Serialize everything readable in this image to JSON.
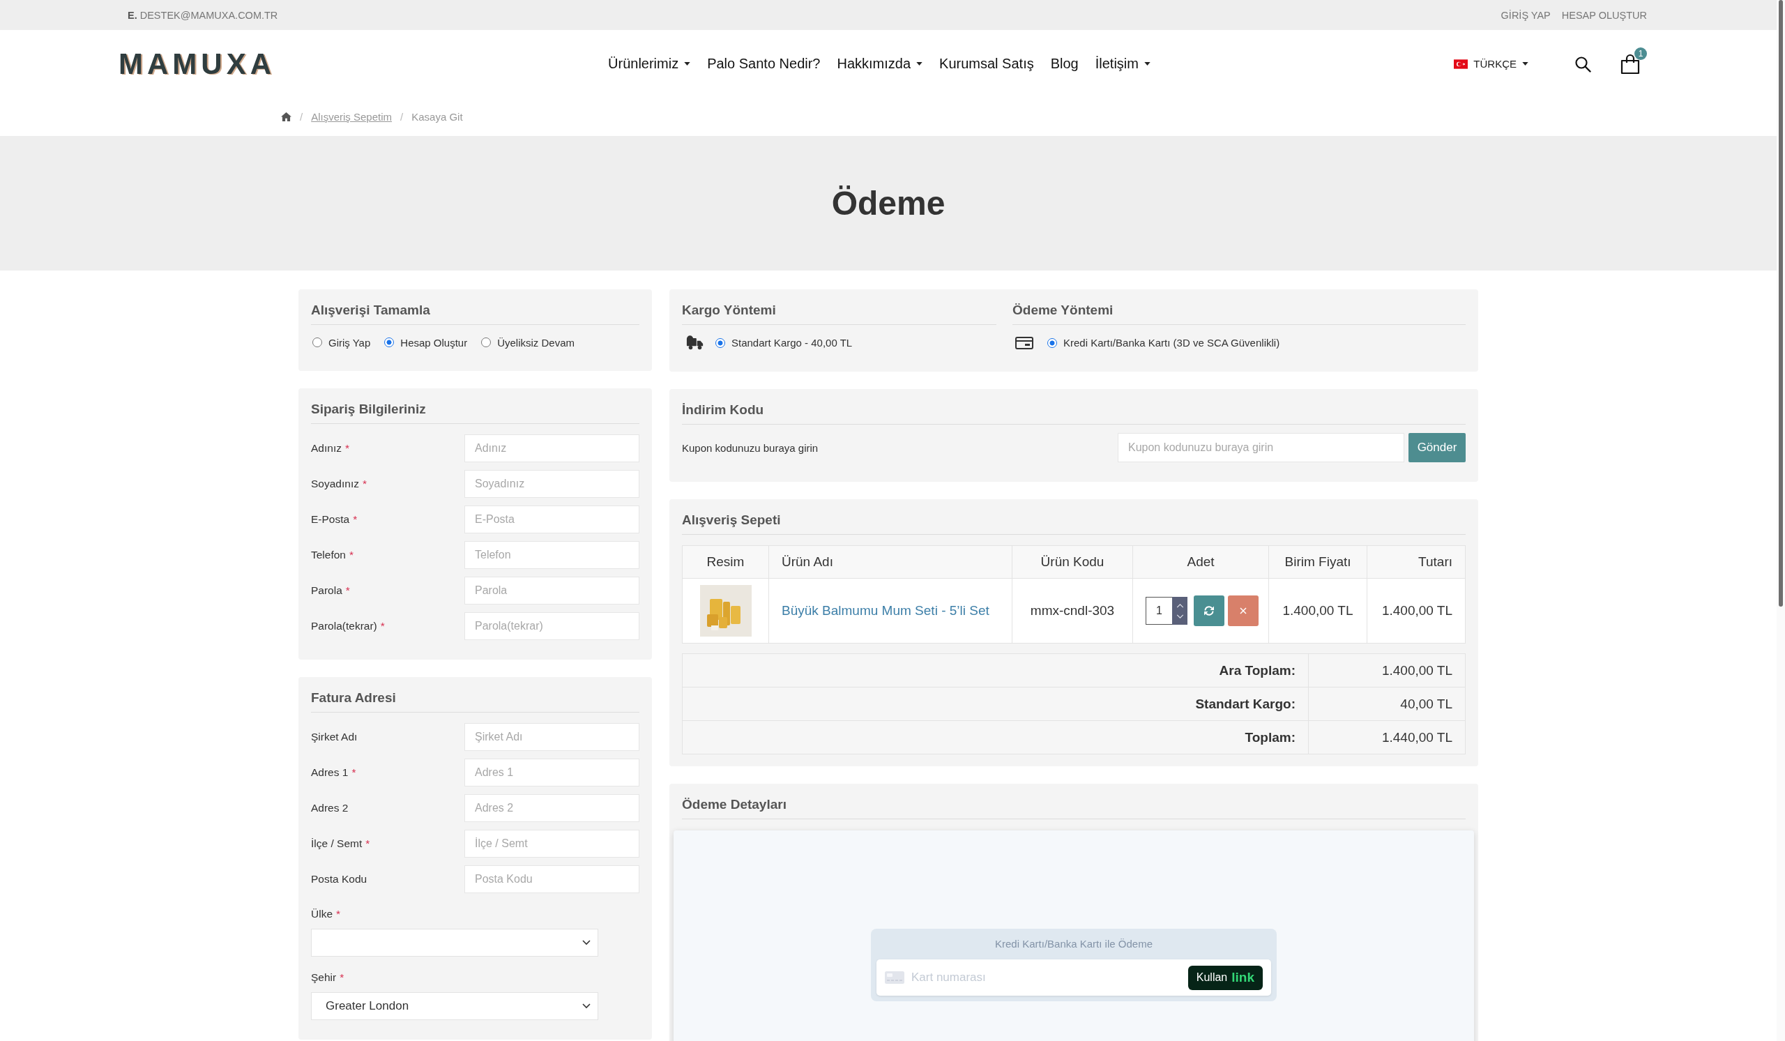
{
  "top_bar": {
    "contact": "**E.** DESTEK@MAMUXA.COM.TR",
    "links": [
      "GİRİŞ YAP",
      "HESAP OLUŞTUR"
    ]
  },
  "header": {
    "logo": "MAMUXA",
    "nav": [
      {
        "label": "Ürünlerimiz",
        "dropdown": true
      },
      {
        "label": "Palo Santo Nedir?",
        "dropdown": false
      },
      {
        "label": "Hakkımızda",
        "dropdown": true
      },
      {
        "label": "Kurumsal Satış",
        "dropdown": false
      },
      {
        "label": "Blog",
        "dropdown": false
      },
      {
        "label": "İletişim",
        "dropdown": true
      }
    ],
    "language": "TÜRKÇE",
    "cart_count": "1"
  },
  "breadcrumb": [
    {
      "kind": "home"
    },
    {
      "kind": "link",
      "separator": "/",
      "label": "Alışveriş Sepetim"
    },
    {
      "kind": "current",
      "separator": "/",
      "label": "Kasaya Git"
    }
  ],
  "page_title": "Ödeme",
  "checkout_type": {
    "title": "Alışverişi Tamamla",
    "options": [
      {
        "label": "Giriş Yap",
        "selected": false
      },
      {
        "label": "Hesap Oluştur",
        "selected": true
      },
      {
        "label": "Üyeliksiz Devam",
        "selected": false
      }
    ]
  },
  "order_info": {
    "title": "Sipariş Bilgileriniz",
    "fields": [
      {
        "kind": "text",
        "label": "Adınız",
        "required_mark": "*",
        "placeholder": "Adınız"
      },
      {
        "kind": "text",
        "label": "Soyadınız",
        "required_mark": "*",
        "placeholder": "Soyadınız"
      },
      {
        "kind": "text",
        "label": "E-Posta",
        "required_mark": "*",
        "placeholder": "E-Posta"
      },
      {
        "kind": "text",
        "label": "Telefon",
        "required_mark": "*",
        "placeholder": "Telefon"
      },
      {
        "kind": "text",
        "label": "Parola",
        "required_mark": "*",
        "placeholder": "Parola"
      },
      {
        "kind": "text",
        "label": "Parola(tekrar)",
        "required_mark": "*",
        "placeholder": "Parola(tekrar)"
      }
    ]
  },
  "billing_address": {
    "title": "Fatura Adresi",
    "fields": [
      {
        "kind": "text",
        "label": "Şirket Adı",
        "placeholder": "Şirket Adı"
      },
      {
        "kind": "text",
        "label": "Adres 1",
        "required_mark": "*",
        "placeholder": "Adres 1"
      },
      {
        "kind": "text",
        "label": "Adres 2",
        "placeholder": "Adres 2"
      },
      {
        "kind": "text",
        "label": "İlçe / Semt",
        "required_mark": "*",
        "placeholder": "İlçe / Semt"
      },
      {
        "kind": "text",
        "label": "Posta Kodu",
        "placeholder": "Posta Kodu"
      },
      {
        "kind": "select",
        "label": "Ülke",
        "required_mark": "*"
      },
      {
        "kind": "select",
        "label": "Şehir",
        "required_mark": "*",
        "value": "Greater London"
      }
    ]
  },
  "shipping": {
    "title": "Kargo Yöntemi",
    "options": [
      {
        "label": "Standart Kargo - 40,00 TL",
        "selected": true
      }
    ]
  },
  "payment_method": {
    "title": "Ödeme Yöntemi",
    "options": [
      {
        "label": "Kredi Kartı/Banka Kartı (3D ve SCA Güvenlikli)",
        "selected": true
      }
    ]
  },
  "discount": {
    "title": "İndirim Kodu",
    "label": "Kupon kodunuzu buraya girin",
    "placeholder": "Kupon kodunuzu buraya girin",
    "button": "Gönder"
  },
  "cart": {
    "title": "Alışveriş Sepeti",
    "columns": [
      "Resim",
      "Ürün Adı",
      "Ürün Kodu",
      "Adet",
      "Birim Fiyatı",
      "Tutarı"
    ],
    "rows": [
      {
        "name": "Büyük Balmumu Mum Seti - 5’li Set",
        "code": "mmx-cndl-303",
        "quantity": "1",
        "unit_price": "1.400,00 TL",
        "total": "1.400,00 TL"
      }
    ],
    "totals": [
      {
        "label": "Ara Toplam:",
        "value": "1.400,00 TL"
      },
      {
        "label": "Standart Kargo:",
        "value": "40,00 TL"
      },
      {
        "label": "Toplam:",
        "value": "1.440,00 TL"
      }
    ]
  },
  "payment_details": {
    "title": "Ödeme Detayları",
    "card_widget": {
      "title": "Kredi Kartı/Banka Kartı ile Ödeme",
      "placeholder": "Kart numarası",
      "button_label": "Kullan",
      "button_brand": "link"
    }
  }
}
